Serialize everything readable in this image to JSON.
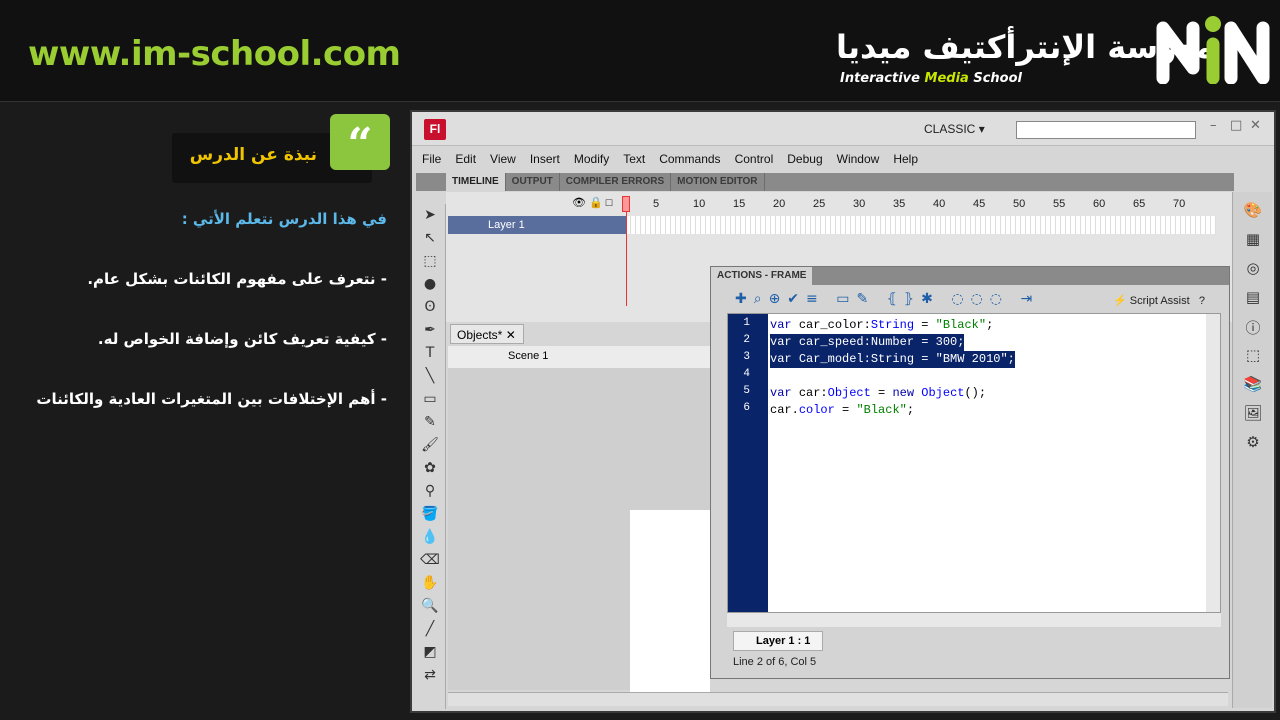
{
  "header": {
    "url": "www.im-school.com",
    "logo_arabic": "مدرسة الإنترأكتيف ميديا",
    "logo_en_1": "Interactive",
    "logo_en_2": "Media",
    "logo_en_3": "School",
    "accent": "#9acd32"
  },
  "lesson": {
    "badge": "نبذة عن الدرس",
    "intro": "في هذا الدرس نتعلم الأتي :",
    "points": [
      "- نتعرف على مفهوم الكائنات بشكل عام.",
      "- كيفية تعريف كائن وإضافة الخواص له.",
      "-  أهم الإختلافات بين المتغيرات العادية والكائنات"
    ]
  },
  "app": {
    "logo": "Fl",
    "workspace": "CLASSIC",
    "search_placeholder": "",
    "menu": [
      "File",
      "Edit",
      "View",
      "Insert",
      "Modify",
      "Text",
      "Commands",
      "Control",
      "Debug",
      "Window",
      "Help"
    ],
    "panel_tabs": [
      "TIMELINE",
      "OUTPUT",
      "COMPILER ERRORS",
      "MOTION EDITOR"
    ],
    "frame_numbers": [
      "5",
      "10",
      "15",
      "20",
      "25",
      "30",
      "35",
      "40",
      "45",
      "50",
      "55",
      "60",
      "65",
      "70"
    ],
    "layer": "Layer 1",
    "doc_tab": "Objects*",
    "scene": "Scene 1",
    "actions": {
      "title": "ACTIONS - FRAME",
      "script_assist": "Script Assist",
      "lines": [
        {
          "n": "1",
          "sel": false,
          "tokens": [
            {
              "t": "var ",
              "c": "kw"
            },
            {
              "t": "car_color:",
              "c": "tx"
            },
            {
              "t": "String",
              "c": "ty"
            },
            {
              "t": " = ",
              "c": "tx"
            },
            {
              "t": "\"Black\"",
              "c": "st"
            },
            {
              "t": ";",
              "c": "tx"
            }
          ]
        },
        {
          "n": "2",
          "sel": true,
          "tokens": [
            {
              "t": "var ",
              "c": "kw"
            },
            {
              "t": "car_speed:",
              "c": "tx"
            },
            {
              "t": "Number",
              "c": "ty"
            },
            {
              "t": " = 300;",
              "c": "tx"
            }
          ]
        },
        {
          "n": "3",
          "sel": true,
          "tokens": [
            {
              "t": "var ",
              "c": "kw"
            },
            {
              "t": "Car_model:",
              "c": "tx"
            },
            {
              "t": "String",
              "c": "ty"
            },
            {
              "t": " = ",
              "c": "tx"
            },
            {
              "t": "\"BMW 2010\"",
              "c": "st"
            },
            {
              "t": ";",
              "c": "tx"
            }
          ]
        },
        {
          "n": "4",
          "sel": false,
          "tokens": []
        },
        {
          "n": "5",
          "sel": false,
          "tokens": [
            {
              "t": "var ",
              "c": "kw"
            },
            {
              "t": "car:",
              "c": "tx"
            },
            {
              "t": "Object",
              "c": "ty"
            },
            {
              "t": " = ",
              "c": "tx"
            },
            {
              "t": "new ",
              "c": "kw"
            },
            {
              "t": "Object",
              "c": "ty"
            },
            {
              "t": "();",
              "c": "tx"
            }
          ]
        },
        {
          "n": "6",
          "sel": false,
          "tokens": [
            {
              "t": "car.",
              "c": "tx"
            },
            {
              "t": "color",
              "c": "ty"
            },
            {
              "t": " = ",
              "c": "tx"
            },
            {
              "t": "\"Black\"",
              "c": "st"
            },
            {
              "t": ";",
              "c": "tx"
            }
          ]
        }
      ],
      "layer_tab": "Layer 1 : 1",
      "status": "Line 2 of 6, Col 5"
    }
  }
}
